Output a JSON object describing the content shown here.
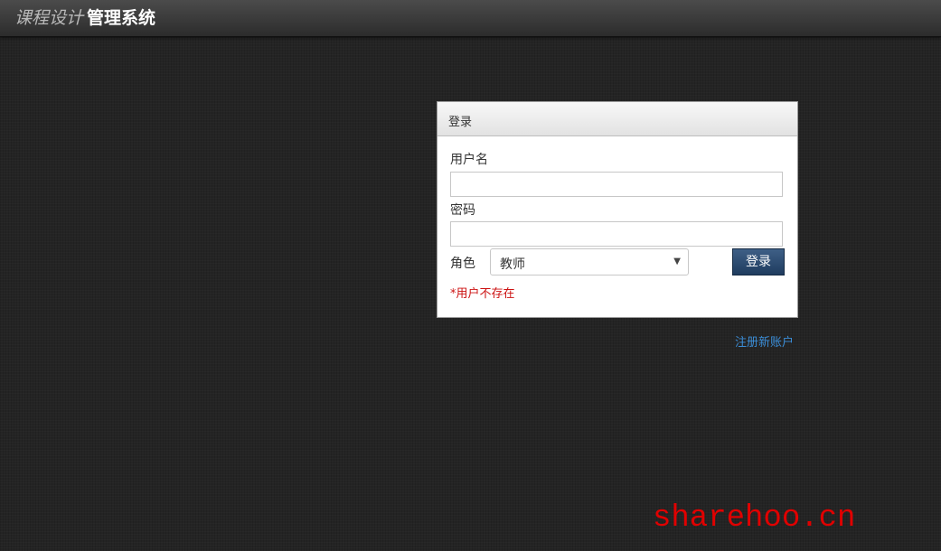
{
  "header": {
    "title_light": "课程设计",
    "title_bold": "管理系统"
  },
  "login_panel": {
    "title": "登录",
    "username_label": "用户名",
    "username_value": "",
    "password_label": "密码",
    "password_value": "",
    "role_label": "角色",
    "role_selected": "教师",
    "role_caret": "▼",
    "login_button": "登录",
    "error_message": "*用户不存在"
  },
  "register_link": "注册新账户",
  "watermark": "sharehoo.cn",
  "colors": {
    "error": "#cc1111",
    "link": "#3b8ed8",
    "button": "#1f3c5f",
    "watermark": "#e00000"
  }
}
